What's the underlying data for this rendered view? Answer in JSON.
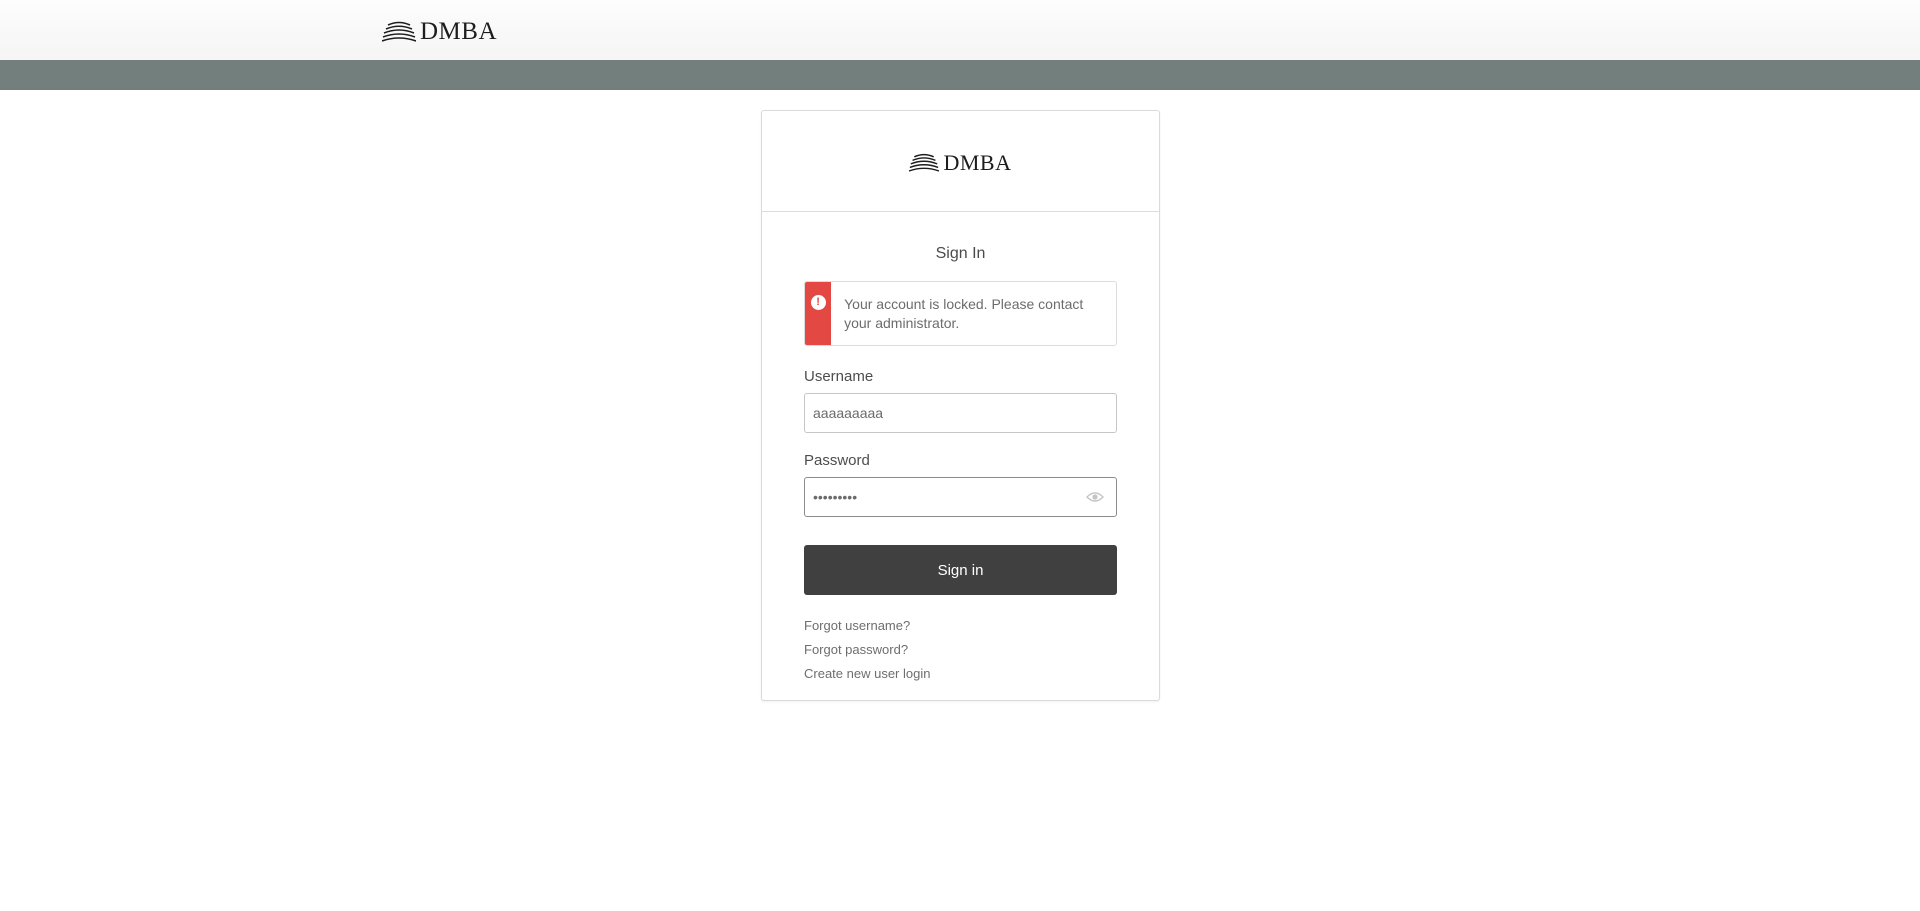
{
  "brand": {
    "logo_text": "DMBA"
  },
  "signin": {
    "title": "Sign In",
    "alert": {
      "message": "Your account is locked. Please contact your administrator.",
      "icon": "exclamation-icon",
      "color": "#e34843"
    },
    "username": {
      "label": "Username",
      "value": "aaaaaaaaa"
    },
    "password": {
      "label": "Password",
      "value": "aaaaaaaaa"
    },
    "button_label": "Sign in",
    "links": {
      "forgot_username": "Forgot username?",
      "forgot_password": "Forgot password?",
      "create_login": "Create new user login"
    }
  },
  "colors": {
    "band": "#737f7c",
    "button": "#404040",
    "alert": "#e34843"
  }
}
